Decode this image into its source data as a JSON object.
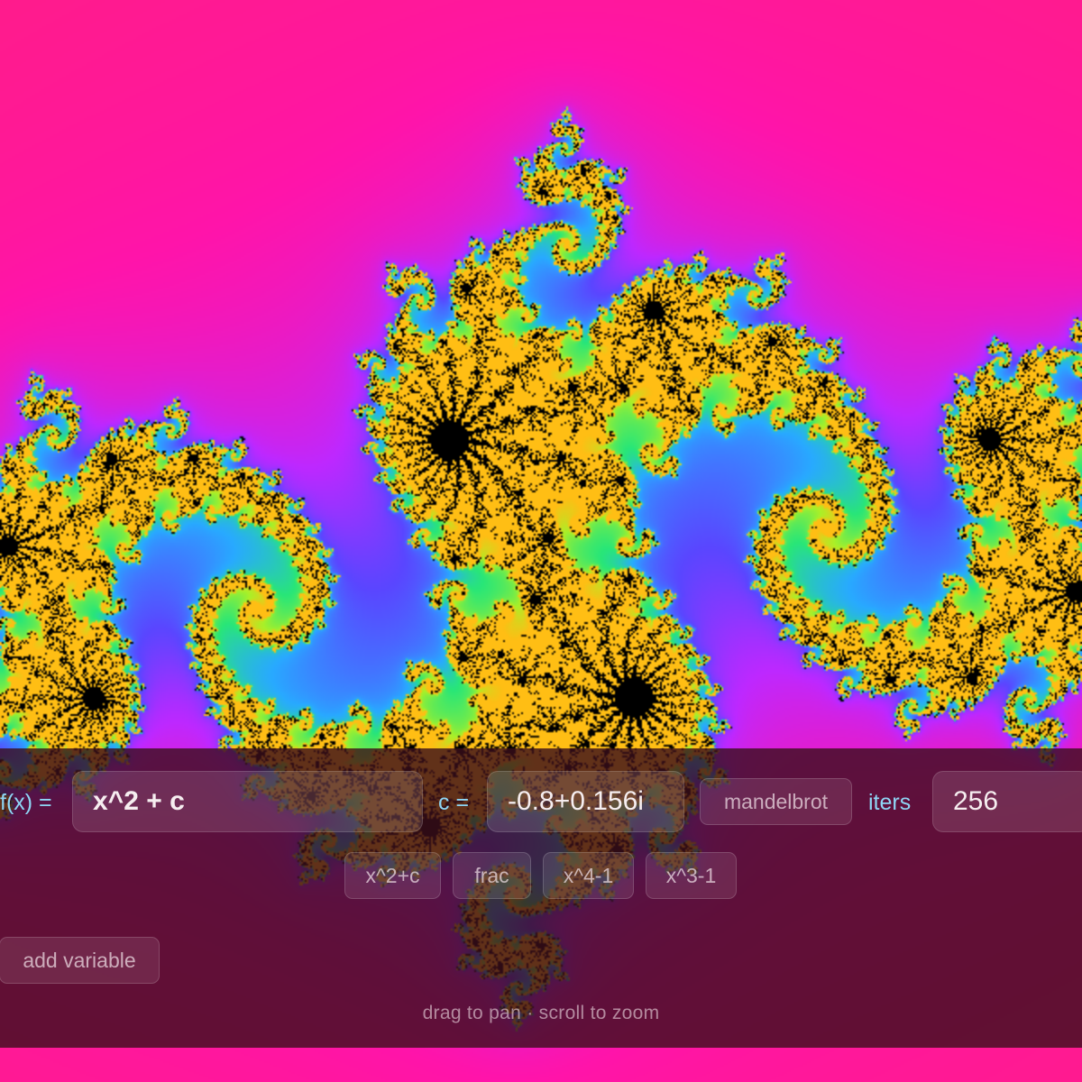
{
  "formula": {
    "label": "f(x) =",
    "value": "x^2 + c"
  },
  "constant": {
    "label": "c =",
    "value": "-0.8+0.156i"
  },
  "mode_button": "mandelbrot",
  "iterations": {
    "label": "iters",
    "value": "256"
  },
  "presets": [
    "x^2+c",
    "frac",
    "x^4-1",
    "x^3-1"
  ],
  "add_variable": "add variable",
  "hint": "drag to pan · scroll to zoom",
  "colors": {
    "background": "#ff2a4f",
    "accent_label": "#8fd6f5",
    "panel": "#3a0e1a"
  }
}
